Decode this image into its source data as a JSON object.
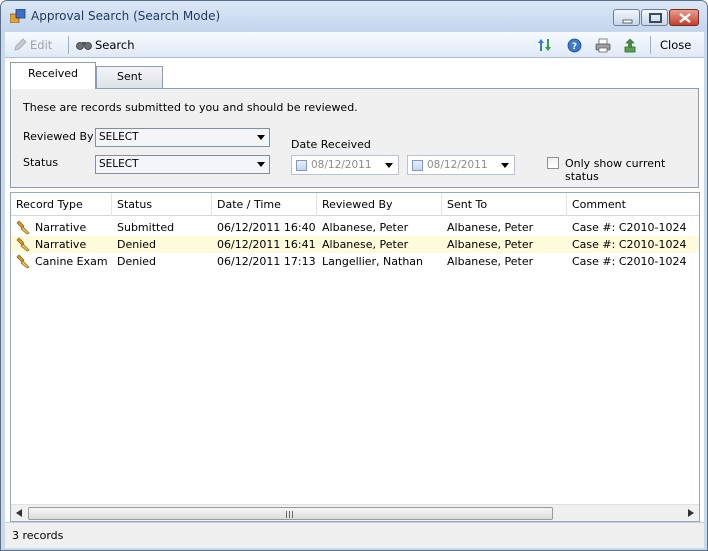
{
  "window": {
    "title": "Approval Search (Search Mode)"
  },
  "toolbar": {
    "edit_label": "Edit",
    "search_label": "Search",
    "close_label": "Close"
  },
  "tabs": [
    {
      "label": "Received",
      "active": true
    },
    {
      "label": "Sent",
      "active": false
    }
  ],
  "criteria": {
    "description": "These are records submitted to you and should be reviewed.",
    "reviewed_by_label": "Reviewed By",
    "reviewed_by_value": "SELECT",
    "status_label": "Status",
    "status_value": "SELECT",
    "date_received_label": "Date Received",
    "date_from": "08/12/2011",
    "date_to": "08/12/2011",
    "current_status_label": "Only show current status"
  },
  "grid": {
    "columns": [
      "Record Type",
      "Status",
      "Date / Time",
      "Reviewed By",
      "Sent To",
      "Comment"
    ],
    "rows": [
      [
        "Narrative",
        "Submitted",
        "06/12/2011 16:40",
        "Albanese, Peter",
        "Albanese, Peter",
        "Case #: C2010-1024"
      ],
      [
        "Narrative",
        "Denied",
        "06/12/2011 16:41",
        "Albanese, Peter",
        "Albanese, Peter",
        "Case #: C2010-1024"
      ],
      [
        "Canine Exam",
        "Denied",
        "06/12/2011 17:13",
        "Langellier, Nathan",
        "Albanese, Peter",
        "Case #: C2010-1024"
      ]
    ],
    "selected_row": 1
  },
  "status": {
    "record_count": "3 records"
  },
  "colors": {
    "selected_row_bg": "#fdfbdc",
    "titlebar": "#c4d6ee",
    "close_button": "#c4402a"
  }
}
